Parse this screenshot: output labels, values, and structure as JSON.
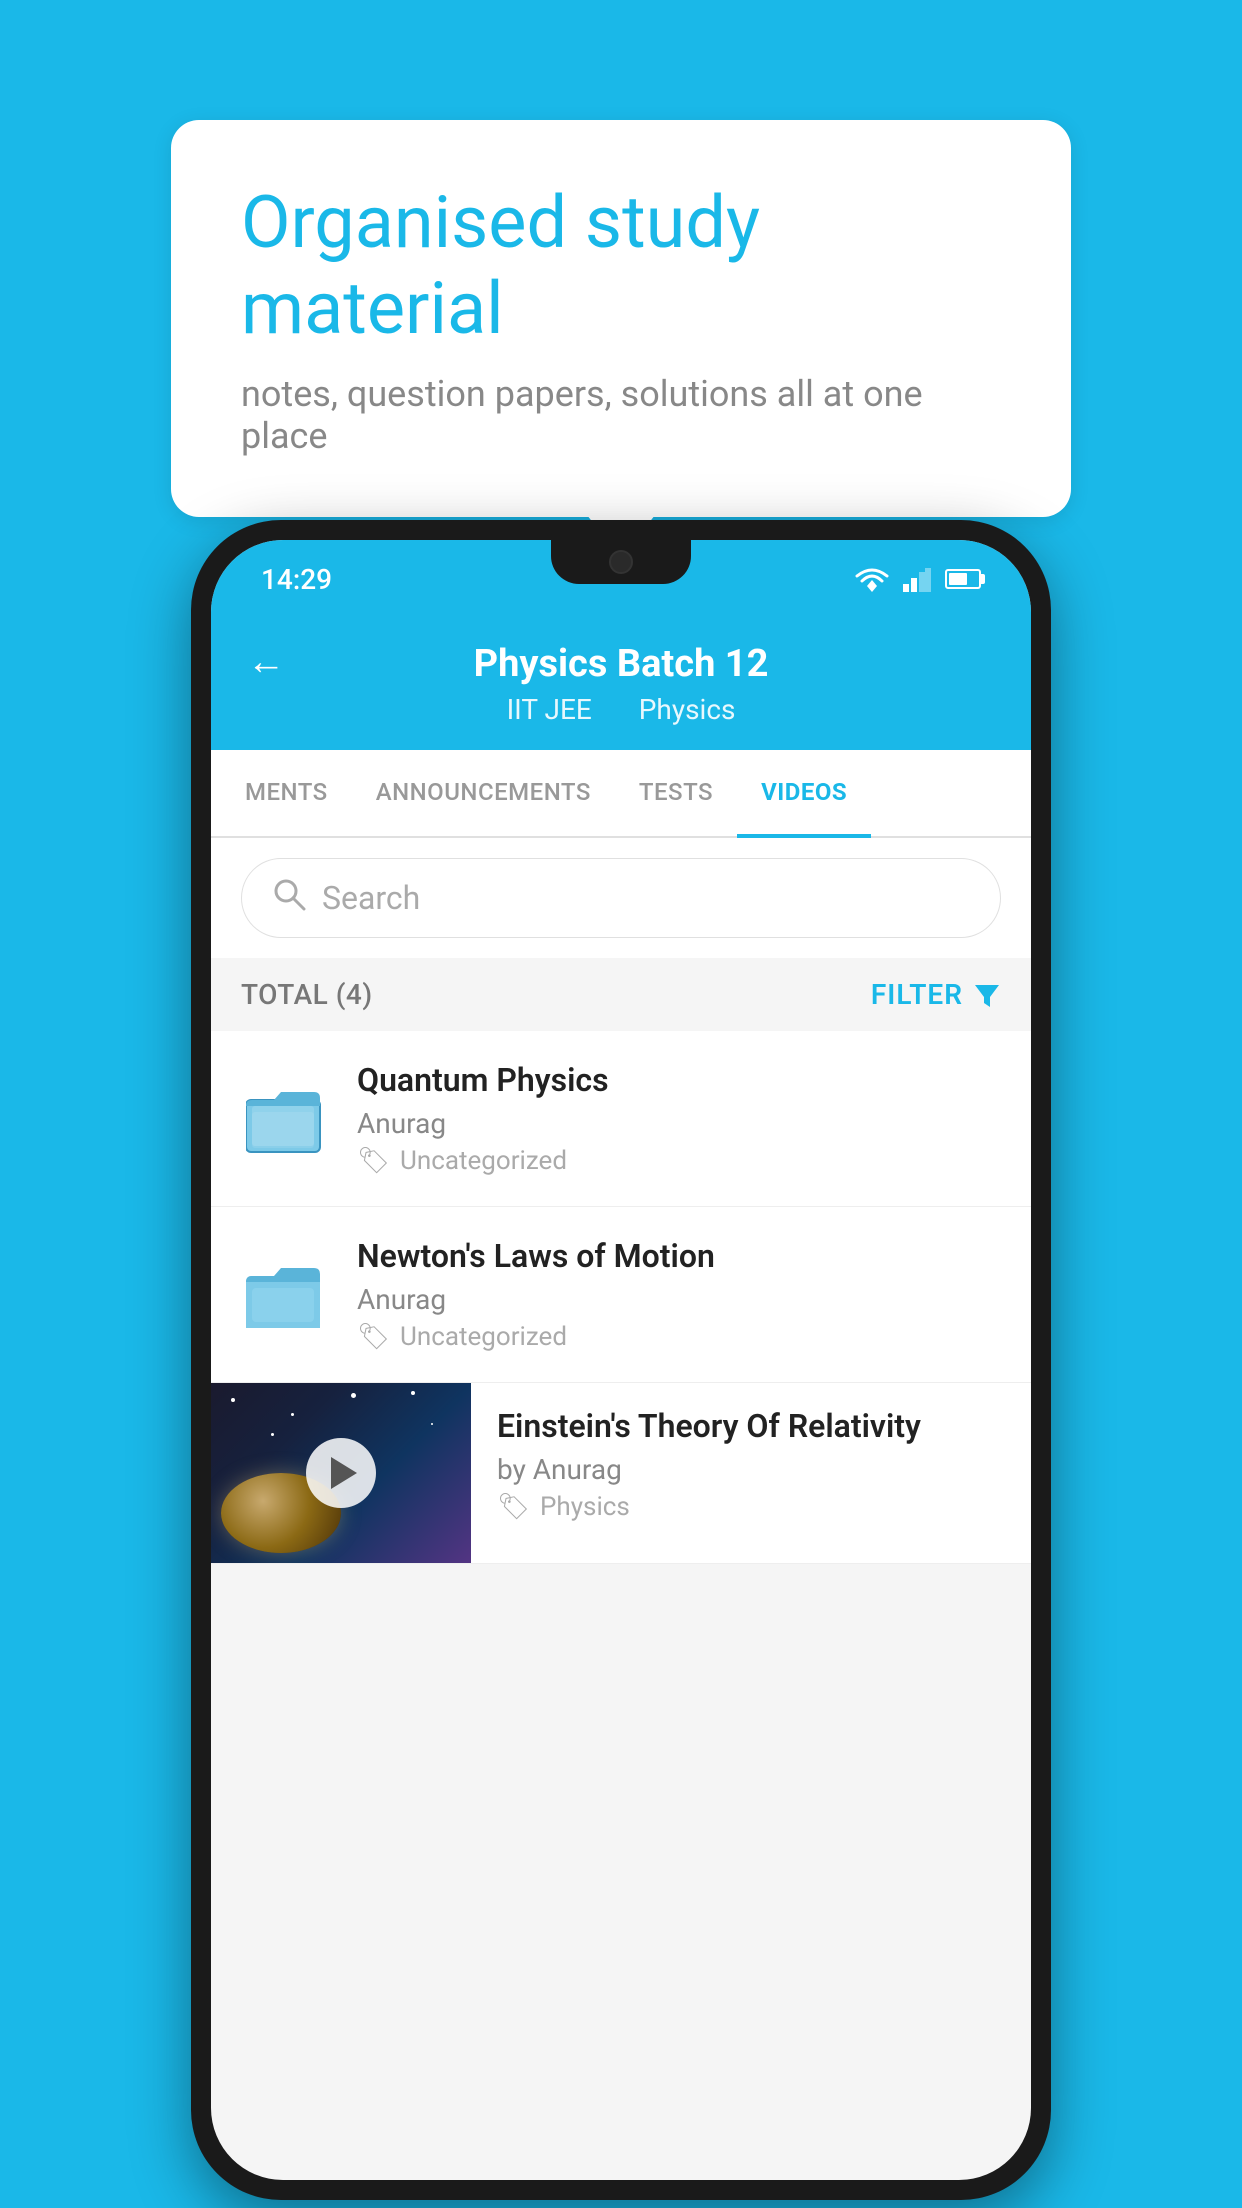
{
  "page": {
    "background_color": "#1ab8e8"
  },
  "bubble": {
    "title": "Organised study material",
    "subtitle": "notes, question papers, solutions all at one place"
  },
  "status_bar": {
    "time": "14:29",
    "wifi": "wifi",
    "signal": "signal",
    "battery": "battery"
  },
  "header": {
    "title": "Physics Batch 12",
    "subtitle_part1": "IIT JEE",
    "subtitle_part2": "Physics",
    "back_label": "←"
  },
  "tabs": [
    {
      "label": "MENTS",
      "active": false
    },
    {
      "label": "ANNOUNCEMENTS",
      "active": false
    },
    {
      "label": "TESTS",
      "active": false
    },
    {
      "label": "VIDEOS",
      "active": true
    }
  ],
  "search": {
    "placeholder": "Search"
  },
  "filter_bar": {
    "total_label": "TOTAL (4)",
    "filter_label": "FILTER"
  },
  "videos": [
    {
      "title": "Quantum Physics",
      "author": "Anurag",
      "tag": "Uncategorized",
      "has_thumbnail": false
    },
    {
      "title": "Newton's Laws of Motion",
      "author": "Anurag",
      "tag": "Uncategorized",
      "has_thumbnail": false
    },
    {
      "title": "Einstein's Theory Of Relativity",
      "author": "by Anurag",
      "tag": "Physics",
      "has_thumbnail": true
    }
  ]
}
